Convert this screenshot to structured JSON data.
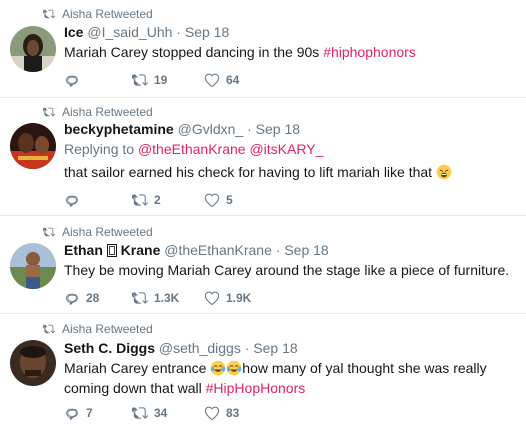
{
  "tweets": [
    {
      "retweeted_by": "Aisha Retweeted",
      "name": "Ice",
      "handle": "@I_said_Uhh",
      "dot": "·",
      "time": "Sep 18",
      "text": "Mariah Carey stopped dancing in the 90s ",
      "hashtag": "#hiphophonors",
      "replies": "",
      "retweets": "19",
      "likes": "64"
    },
    {
      "retweeted_by": "Aisha Retweeted",
      "name": "beckyphetamine",
      "handle": "@Gvldxn_",
      "dot": "·",
      "time": "Sep 18",
      "replying_prefix": "Replying to ",
      "replying_user1": "@theEthanKrane",
      "replying_user2": "@itsKARY_",
      "text": "that sailor earned his check for having to lift mariah like that",
      "replies": "",
      "retweets": "2",
      "likes": "5"
    },
    {
      "retweeted_by": "Aisha Retweeted",
      "name_part1": "Ethan",
      "name_part2": "Krane",
      "handle": "@theEthanKrane",
      "dot": "·",
      "time": "Sep 18",
      "text": "They be moving Mariah Carey around the stage like a piece of furniture.",
      "replies": "28",
      "retweets": "1.3K",
      "likes": "1.9K"
    },
    {
      "retweeted_by": "Aisha Retweeted",
      "name": "Seth C. Diggs",
      "handle": "@seth_diggs",
      "dot": "·",
      "time": "Sep 18",
      "text_part1": "Mariah Carey entrance ",
      "text_part2": "how many of yal thought she was really coming down that wall ",
      "hashtag": "#HipHopHonors",
      "replies": "7",
      "retweets": "34",
      "likes": "83"
    }
  ],
  "colors": {
    "hashtag": "#e0245e",
    "link": "#1b95e0",
    "muted": "#657786",
    "divider": "#e6ecf0"
  }
}
